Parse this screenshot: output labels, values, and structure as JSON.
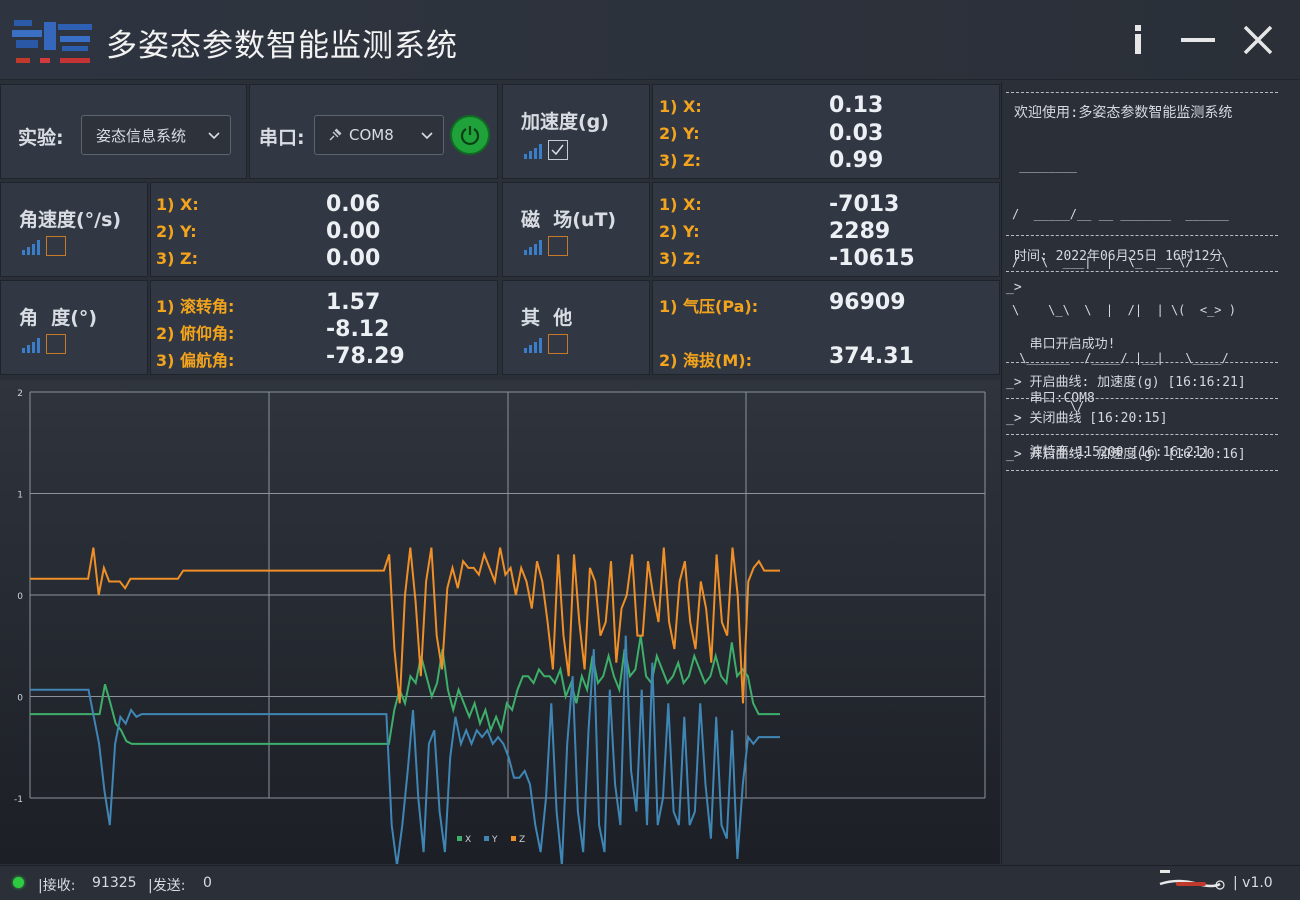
{
  "app": {
    "title": "多姿态参数智能监测系统"
  },
  "experiment": {
    "label": "实验:",
    "selected": "姿态信息系统"
  },
  "serial": {
    "label": "串口:",
    "selected": "COM8"
  },
  "accel": {
    "label": "加速度(g)",
    "checked": true,
    "rows": [
      {
        "k": "1) X:",
        "v": "0.13"
      },
      {
        "k": "2) Y:",
        "v": "0.03"
      },
      {
        "k": "3) Z:",
        "v": "0.99"
      }
    ]
  },
  "gyro": {
    "label": "角速度(°/s)",
    "checked": false,
    "rows": [
      {
        "k": "1) X:",
        "v": "0.06"
      },
      {
        "k": "2) Y:",
        "v": "0.00"
      },
      {
        "k": "3) Z:",
        "v": "0.00"
      }
    ]
  },
  "mag": {
    "label": "磁  场(uT)",
    "checked": false,
    "rows": [
      {
        "k": "1) X:",
        "v": "-7013"
      },
      {
        "k": "2) Y:",
        "v": "2289"
      },
      {
        "k": "3) Z:",
        "v": "-10615"
      }
    ]
  },
  "angle": {
    "label": "角  度(°)",
    "checked": false,
    "rows": [
      {
        "k": "1) 滚转角:",
        "v": "1.57"
      },
      {
        "k": "2) 俯仰角:",
        "v": "-8.12"
      },
      {
        "k": "3) 偏航角:",
        "v": "-78.29"
      }
    ]
  },
  "other": {
    "label": "其  他",
    "checked": false,
    "rows": [
      {
        "k": "1) 气压(Pa):",
        "v": "96909"
      },
      {
        "k": "2) 海拔(M):",
        "v": "374.31"
      }
    ]
  },
  "log": {
    "welcome": "欢迎使用:多姿态参数智能监测系统",
    "ascii": [
      " ________",
      "/  _____/__ __ _______  ______",
      "/   \\  ___|  |  \\_  __ \\/  _ \\",
      "\\    \\_\\  \\  |  /|  | \\(  <_> )",
      " \\______  /____/ |__|   \\____/",
      "        \\/"
    ],
    "time": "时间: 2022年06月25日 16时12分",
    "prompt": "_>",
    "open_lines": [
      "  串口开启成功!",
      "  串口:COM8",
      "  波特率:115200 [16:16:21]"
    ],
    "entries": [
      "_> 开启曲线: 加速度(g) [16:16:21]",
      "_> 关闭曲线 [16:20:15]",
      "_> 开启曲线: 加速度(g) [16:20:16]"
    ]
  },
  "status": {
    "recv_label": "|接收:",
    "recv": "91325",
    "send_label": "|发送:",
    "send": "0",
    "version": "| v1.0",
    "led_color": "#2ecc40"
  },
  "colors": {
    "orange": "#f3a41c",
    "x": "#3daf6a",
    "y": "#3f86b5",
    "z": "#ee8f27"
  },
  "chart_data": {
    "type": "line",
    "ylim": [
      -1,
      2
    ],
    "yticks": [
      "2",
      "1",
      "0",
      "0",
      "-1"
    ],
    "legend": [
      "X",
      "Y",
      "Z"
    ],
    "legend_position": "bottom",
    "grid": true,
    "series": [
      {
        "name": "X",
        "color": "#3daf6a",
        "values": [
          -0.38,
          -0.38,
          -0.38,
          -0.38,
          -0.38,
          -0.38,
          -0.38,
          -0.38,
          -0.38,
          -0.38,
          -0.38,
          -0.38,
          -0.38,
          -0.38,
          -0.16,
          -0.3,
          -0.45,
          -0.5,
          -0.58,
          -0.6,
          -0.6,
          -0.6,
          -0.6,
          -0.6,
          -0.6,
          -0.6,
          -0.6,
          -0.6,
          -0.6,
          -0.6,
          -0.6,
          -0.6,
          -0.6,
          -0.6,
          -0.6,
          -0.6,
          -0.6,
          -0.6,
          -0.6,
          -0.6,
          -0.6,
          -0.6,
          -0.6,
          -0.6,
          -0.6,
          -0.6,
          -0.6,
          -0.6,
          -0.6,
          -0.6,
          -0.6,
          -0.6,
          -0.6,
          -0.6,
          -0.6,
          -0.6,
          -0.6,
          -0.6,
          -0.6,
          -0.6,
          -0.6,
          -0.6,
          -0.6,
          -0.6,
          -0.6,
          -0.6,
          -0.6,
          -0.6,
          -0.35,
          -0.2,
          -0.3,
          -0.1,
          -0.15,
          0.05,
          -0.1,
          -0.25,
          -0.15,
          0.1,
          -0.2,
          -0.35,
          -0.2,
          -0.3,
          -0.4,
          -0.3,
          -0.45,
          -0.35,
          -0.5,
          -0.4,
          -0.5,
          -0.3,
          -0.35,
          -0.2,
          -0.1,
          -0.1,
          -0.15,
          -0.05,
          -0.1,
          -0.1,
          -0.15,
          -0.05,
          -0.25,
          -0.15,
          -0.3,
          -0.1,
          -0.2,
          0.05,
          -0.15,
          -0.1,
          0.05,
          -0.1,
          -0.2,
          0.1,
          -0.1,
          -0.05,
          0.2,
          -0.1,
          -0.15,
          0.05,
          -0.05,
          -0.15,
          -0.1,
          0.0,
          -0.15,
          -0.1,
          0.05,
          -0.05,
          -0.15,
          -0.1,
          0.05,
          -0.1,
          -0.15,
          0.15,
          -0.1,
          -0.05,
          -0.1,
          -0.3,
          -0.38,
          -0.38,
          -0.38,
          -0.38,
          -0.38
        ]
      },
      {
        "name": "Y",
        "color": "#3f86b5",
        "values": [
          -0.2,
          -0.2,
          -0.2,
          -0.2,
          -0.2,
          -0.2,
          -0.2,
          -0.2,
          -0.2,
          -0.2,
          -0.2,
          -0.2,
          -0.4,
          -0.6,
          -0.95,
          -1.2,
          -0.6,
          -0.4,
          -0.45,
          -0.35,
          -0.4,
          -0.38,
          -0.38,
          -0.38,
          -0.38,
          -0.38,
          -0.38,
          -0.38,
          -0.38,
          -0.38,
          -0.38,
          -0.38,
          -0.38,
          -0.38,
          -0.38,
          -0.38,
          -0.38,
          -0.38,
          -0.38,
          -0.38,
          -0.38,
          -0.38,
          -0.38,
          -0.38,
          -0.38,
          -0.38,
          -0.38,
          -0.38,
          -0.38,
          -0.38,
          -0.38,
          -0.38,
          -0.38,
          -0.38,
          -0.38,
          -0.38,
          -0.38,
          -0.38,
          -0.38,
          -0.38,
          -0.38,
          -0.38,
          -0.38,
          -0.38,
          -0.38,
          -0.38,
          -0.38,
          -0.38,
          -1.2,
          -1.5,
          -1.2,
          -0.8,
          -0.35,
          -1.0,
          -1.4,
          -0.6,
          -0.5,
          -1.1,
          -1.4,
          -0.7,
          -0.4,
          -0.6,
          -0.5,
          -0.6,
          -0.5,
          -0.55,
          -0.5,
          -0.6,
          -0.55,
          -0.6,
          -0.7,
          -0.85,
          -0.85,
          -0.8,
          -0.9,
          -1.2,
          -1.4,
          -1.0,
          -0.3,
          -1.1,
          -1.5,
          -0.6,
          -0.1,
          -1.1,
          -1.4,
          -0.5,
          0.1,
          -1.2,
          -1.4,
          -0.2,
          -0.9,
          -1.2,
          0.2,
          -0.8,
          -1.1,
          -0.2,
          -1.2,
          0.0,
          -1.2,
          -1.0,
          -0.3,
          -1.1,
          -1.2,
          -0.4,
          -1.2,
          -1.1,
          -0.3,
          -0.9,
          -1.3,
          -0.4,
          -1.2,
          -1.3,
          -0.5,
          -1.45,
          -0.9,
          -0.55,
          -0.6,
          -0.55,
          -0.55,
          -0.55,
          -0.55,
          -0.55
        ]
      },
      {
        "name": "Z",
        "color": "#ee8f27",
        "values": [
          0.62,
          0.62,
          0.62,
          0.62,
          0.62,
          0.62,
          0.62,
          0.62,
          0.62,
          0.62,
          0.62,
          0.62,
          0.85,
          0.5,
          0.7,
          0.6,
          0.6,
          0.6,
          0.55,
          0.62,
          0.62,
          0.62,
          0.62,
          0.62,
          0.62,
          0.62,
          0.62,
          0.62,
          0.62,
          0.68,
          0.68,
          0.68,
          0.68,
          0.68,
          0.68,
          0.68,
          0.68,
          0.68,
          0.68,
          0.68,
          0.68,
          0.68,
          0.68,
          0.68,
          0.68,
          0.68,
          0.68,
          0.68,
          0.68,
          0.68,
          0.68,
          0.68,
          0.68,
          0.68,
          0.68,
          0.68,
          0.68,
          0.68,
          0.68,
          0.68,
          0.68,
          0.68,
          0.68,
          0.68,
          0.68,
          0.68,
          0.68,
          0.68,
          0.8,
          0.1,
          -0.3,
          0.5,
          0.85,
          0.45,
          -0.1,
          0.6,
          0.85,
          0.2,
          -0.05,
          0.55,
          0.7,
          0.55,
          0.75,
          0.7,
          0.7,
          0.65,
          0.8,
          0.7,
          0.6,
          0.85,
          0.65,
          0.7,
          0.5,
          0.7,
          0.6,
          0.4,
          0.75,
          0.6,
          0.3,
          -0.05,
          0.8,
          0.2,
          -0.1,
          0.8,
          0.3,
          -0.05,
          0.7,
          0.6,
          0.2,
          0.3,
          0.75,
          0.0,
          0.4,
          0.5,
          0.8,
          0.2,
          0.2,
          0.75,
          0.5,
          0.3,
          0.85,
          0.3,
          0.1,
          0.6,
          0.75,
          0.3,
          0.1,
          0.6,
          0.4,
          0.0,
          0.8,
          0.3,
          0.2,
          0.85,
          0.5,
          -0.3,
          0.6,
          0.7,
          0.75,
          0.68,
          0.68,
          0.68,
          0.68
        ]
      }
    ]
  }
}
